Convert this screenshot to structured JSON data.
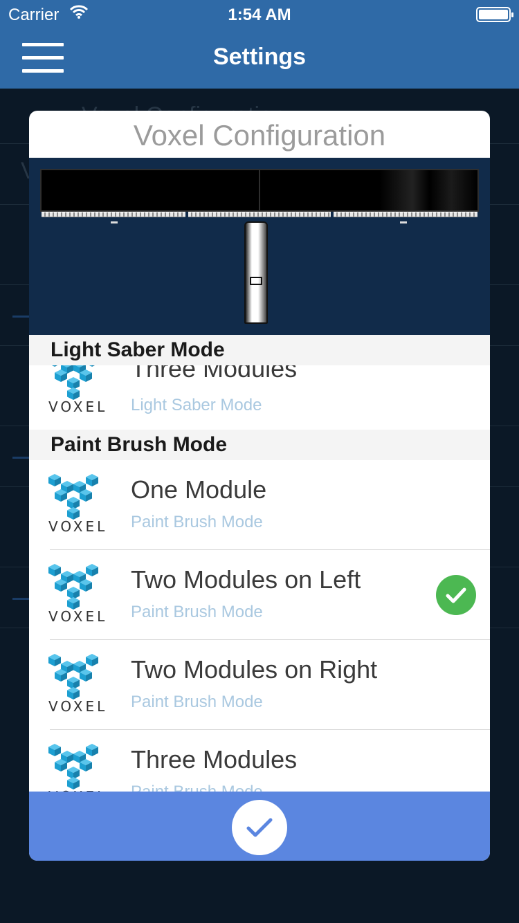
{
  "status": {
    "carrier": "Carrier",
    "time": "1:54 AM"
  },
  "nav": {
    "title": "Settings"
  },
  "background": {
    "row1": "Voxel Configuration",
    "row2": "V"
  },
  "modal": {
    "title": "Voxel Configuration"
  },
  "sections": [
    {
      "header": "Light Saber Mode"
    },
    {
      "header": "Paint Brush Mode"
    }
  ],
  "rows": [
    {
      "title": "Three Modules",
      "subtitle": "Light Saber Mode",
      "selected": false
    },
    {
      "title": "One Module",
      "subtitle": "Paint Brush Mode",
      "selected": false
    },
    {
      "title": "Two Modules on Left",
      "subtitle": "Paint Brush Mode",
      "selected": true
    },
    {
      "title": "Two Modules on Right",
      "subtitle": "Paint Brush Mode",
      "selected": false
    },
    {
      "title": "Three Modules",
      "subtitle": "Paint Brush Mode",
      "selected": false
    }
  ],
  "logo": {
    "wordmark": "VOXEL",
    "icon": "voxel-cube-logo"
  },
  "colors": {
    "nav": "#2f6aa7",
    "accent": "#5b86e0",
    "check": "#4cb852",
    "logo": "#1d9fd1"
  }
}
